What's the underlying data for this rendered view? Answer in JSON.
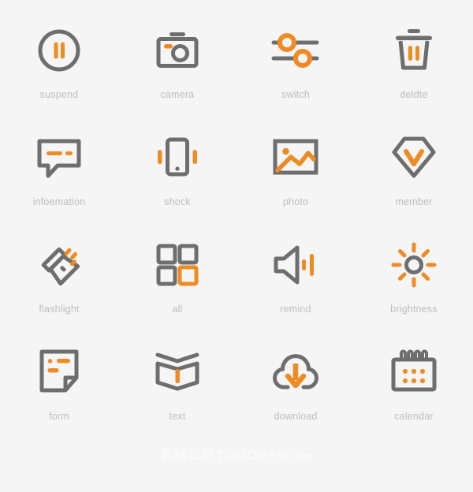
{
  "palette": {
    "background": "#f5f5f5",
    "stroke_gray": "#6e6e6e",
    "accent_orange": "#ee8b22",
    "label_gray": "#bdbdbd",
    "watermark": "#ffffff"
  },
  "grid": {
    "columns": 4,
    "rows": 4,
    "count": 16
  },
  "icons": [
    {
      "id": "suspend",
      "label": "suspend",
      "glyph": "pause-circle-icon"
    },
    {
      "id": "camera",
      "label": "camera",
      "glyph": "camera-icon"
    },
    {
      "id": "switch",
      "label": "switch",
      "glyph": "sliders-switch-icon"
    },
    {
      "id": "delete",
      "label": "deldte",
      "glyph": "trash-can-icon"
    },
    {
      "id": "information",
      "label": "infoemation",
      "glyph": "speech-bubble-icon"
    },
    {
      "id": "shock",
      "label": "shock",
      "glyph": "phone-vibrate-icon"
    },
    {
      "id": "photo",
      "label": "photo",
      "glyph": "picture-icon"
    },
    {
      "id": "member",
      "label": "member",
      "glyph": "diamond-check-icon"
    },
    {
      "id": "flashlight",
      "label": "flashlight",
      "glyph": "flashlight-icon"
    },
    {
      "id": "all",
      "label": "all",
      "glyph": "grid-squares-icon"
    },
    {
      "id": "remind",
      "label": "remind",
      "glyph": "speaker-volume-icon"
    },
    {
      "id": "brightness",
      "label": "brightness",
      "glyph": "sun-brightness-icon"
    },
    {
      "id": "form",
      "label": "form",
      "glyph": "document-form-icon"
    },
    {
      "id": "text",
      "label": "text",
      "glyph": "open-book-icon"
    },
    {
      "id": "download",
      "label": "download",
      "glyph": "cloud-download-icon"
    },
    {
      "id": "calendar",
      "label": "calendar",
      "glyph": "calendar-icon"
    }
  ],
  "watermark": {
    "text_cn": "素材公社",
    "text_en": "TOOOPEN",
    "text_domain": ".com"
  }
}
